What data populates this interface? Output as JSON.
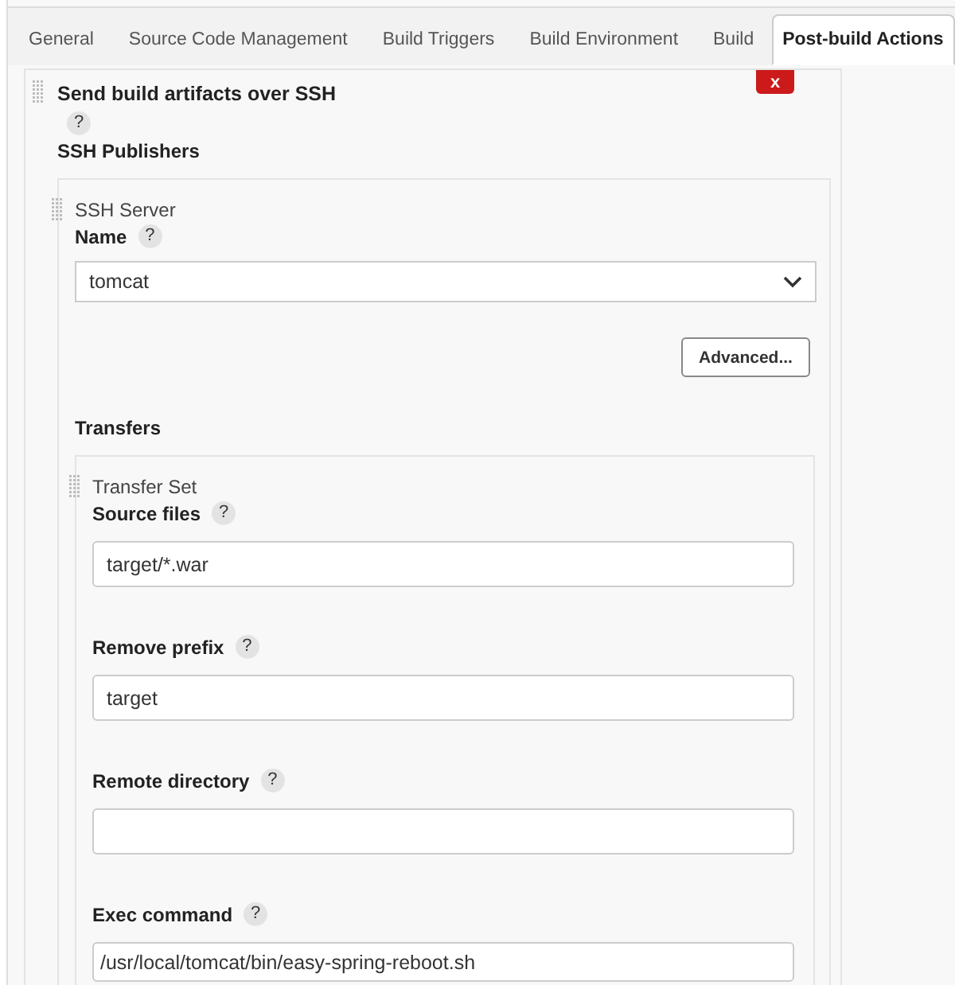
{
  "tabs": [
    {
      "label": "General",
      "selected": false
    },
    {
      "label": "Source Code Management",
      "selected": false
    },
    {
      "label": "Build Triggers",
      "selected": false
    },
    {
      "label": "Build Environment",
      "selected": false
    },
    {
      "label": "Build",
      "selected": false
    },
    {
      "label": "Post-build Actions",
      "selected": true
    }
  ],
  "publisher": {
    "title": "Send build artifacts over SSH",
    "help": "?",
    "close": "x",
    "section": "SSH Publishers",
    "server": {
      "heading": "SSH Server",
      "name_label": "Name",
      "help": "?",
      "name_value": "tomcat",
      "advanced": "Advanced...",
      "transfers": "Transfers",
      "transfer_set": {
        "heading": "Transfer Set",
        "fields": [
          {
            "label": "Source files",
            "help": "?",
            "value": "target/*.war"
          },
          {
            "label": "Remove prefix",
            "help": "?",
            "value": "target"
          },
          {
            "label": "Remote directory",
            "help": "?"
          },
          {
            "label": "Exec command",
            "help": "?",
            "value": "/usr/local/tomcat/bin/easy-spring-reboot.sh"
          }
        ]
      }
    }
  }
}
